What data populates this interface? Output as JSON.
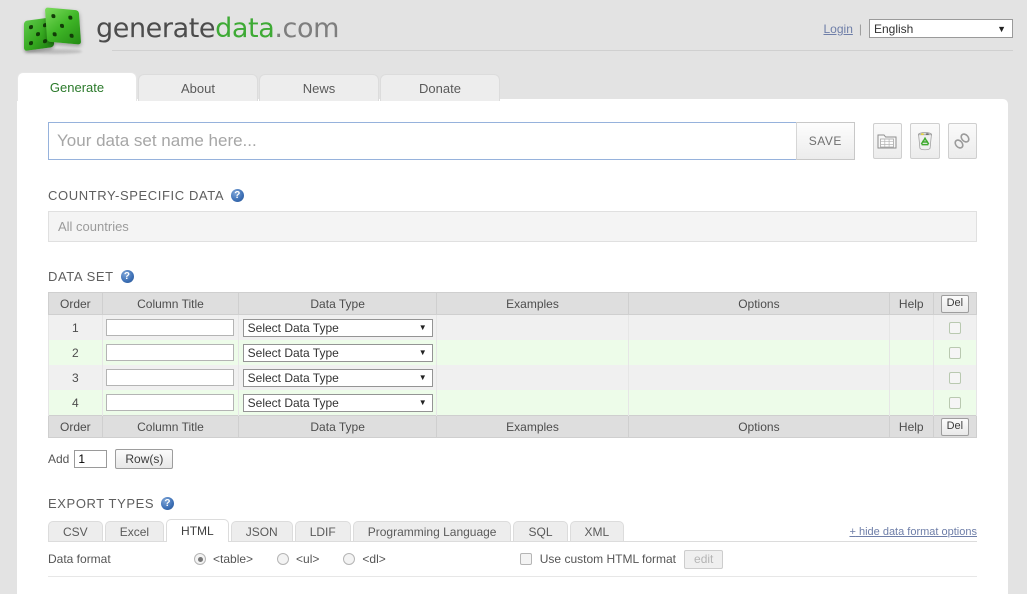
{
  "header": {
    "logo_text_1": "generate",
    "logo_text_2": "data",
    "logo_text_3": ".com",
    "login_label": "Login",
    "separator": "|",
    "language_value": "English",
    "caret": "▼"
  },
  "main_tabs": [
    {
      "label": "Generate",
      "active": true
    },
    {
      "label": "About",
      "active": false
    },
    {
      "label": "News",
      "active": false
    },
    {
      "label": "Donate",
      "active": false
    }
  ],
  "dataset_name": {
    "value": "",
    "placeholder": "Your data set name here...",
    "save_label": "SAVE"
  },
  "toolbar_icons": [
    {
      "name": "grid-folder-icon"
    },
    {
      "name": "recycle-bin-icon"
    },
    {
      "name": "link-chain-icon"
    }
  ],
  "country_section": {
    "title": "COUNTRY-SPECIFIC DATA",
    "help": "?",
    "value": "All countries"
  },
  "dataset_section": {
    "title": "DATA SET",
    "help": "?",
    "columns": [
      "Order",
      "Column Title",
      "Data Type",
      "Examples",
      "Options",
      "Help",
      "Del"
    ],
    "del_button_label": "Del",
    "rows": [
      {
        "order": "1",
        "title": "",
        "data_type": "Select Data Type",
        "examples": "",
        "options": "",
        "help": "",
        "del_checked": false
      },
      {
        "order": "2",
        "title": "",
        "data_type": "Select Data Type",
        "examples": "",
        "options": "",
        "help": "",
        "del_checked": false
      },
      {
        "order": "3",
        "title": "",
        "data_type": "Select Data Type",
        "examples": "",
        "options": "",
        "help": "",
        "del_checked": false
      },
      {
        "order": "4",
        "title": "",
        "data_type": "Select Data Type",
        "examples": "",
        "options": "",
        "help": "",
        "del_checked": false
      }
    ],
    "add_label": "Add",
    "add_count": "1",
    "add_rows_button": "Row(s)"
  },
  "export_section": {
    "title": "EXPORT TYPES",
    "help": "?",
    "tabs": [
      {
        "label": "CSV",
        "active": false
      },
      {
        "label": "Excel",
        "active": false
      },
      {
        "label": "HTML",
        "active": true
      },
      {
        "label": "JSON",
        "active": false
      },
      {
        "label": "LDIF",
        "active": false
      },
      {
        "label": "Programming Language",
        "active": false
      },
      {
        "label": "SQL",
        "active": false
      },
      {
        "label": "XML",
        "active": false
      }
    ],
    "hide_options_plus": "+",
    "hide_options_label": "hide data format options"
  },
  "format_row": {
    "label": "Data format",
    "options": [
      {
        "label": "<table>",
        "checked": true
      },
      {
        "label": "<ul>",
        "checked": false
      },
      {
        "label": "<dl>",
        "checked": false
      }
    ],
    "custom_checked": false,
    "custom_label": "Use custom HTML format",
    "edit_label": "edit"
  },
  "colors": {
    "page_background": "#e3e3e3",
    "panel_background": "#ffffff",
    "accent_green": "#3eaa35",
    "link_blue": "#6e7ea8",
    "row_even_green": "#edfce9",
    "row_odd_gray": "#f0f0f0",
    "table_header_gray": "#dedede",
    "input_focus_border": "#96b2dc"
  }
}
